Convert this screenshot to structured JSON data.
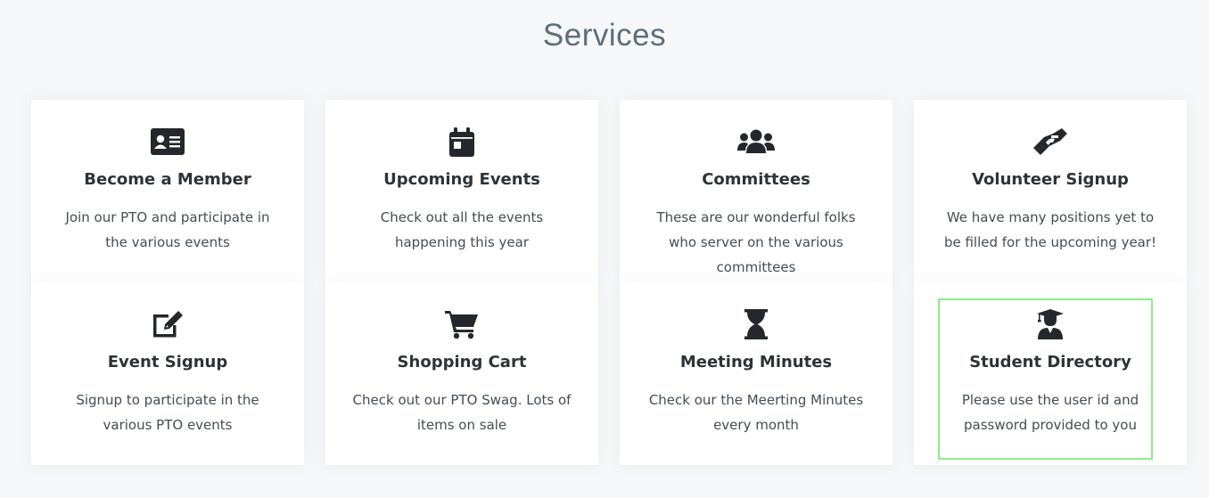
{
  "section": {
    "title": "Services"
  },
  "cards": [
    {
      "icon": "id-card-icon",
      "title": "Become a Member",
      "description": "Join our PTO and participate in the various events"
    },
    {
      "icon": "calendar-icon",
      "title": "Upcoming Events",
      "description": "Check out all the events happening this year"
    },
    {
      "icon": "users-icon",
      "title": "Committees",
      "description": "These are our wonderful folks who server on the various committees"
    },
    {
      "icon": "hands-helping-icon",
      "title": "Volunteer Signup",
      "description": "We have many positions yet to be filled for the upcoming year!"
    },
    {
      "icon": "edit-icon",
      "title": "Event Signup",
      "description": "Signup to participate in the various PTO events"
    },
    {
      "icon": "shopping-cart-icon",
      "title": "Shopping Cart",
      "description": "Check out our PTO Swag. Lots of items on sale"
    },
    {
      "icon": "hourglass-icon",
      "title": "Meeting Minutes",
      "description": "Check our the Meerting Minutes every month"
    },
    {
      "icon": "graduate-icon",
      "title": "Student Directory",
      "description": "Please use the user id and password provided to you"
    }
  ],
  "colors": {
    "background": "#f6f7f9",
    "card": "#ffffff",
    "title": "#5e6e7a",
    "icon": "#24282c",
    "highlight": "#8aee88"
  }
}
